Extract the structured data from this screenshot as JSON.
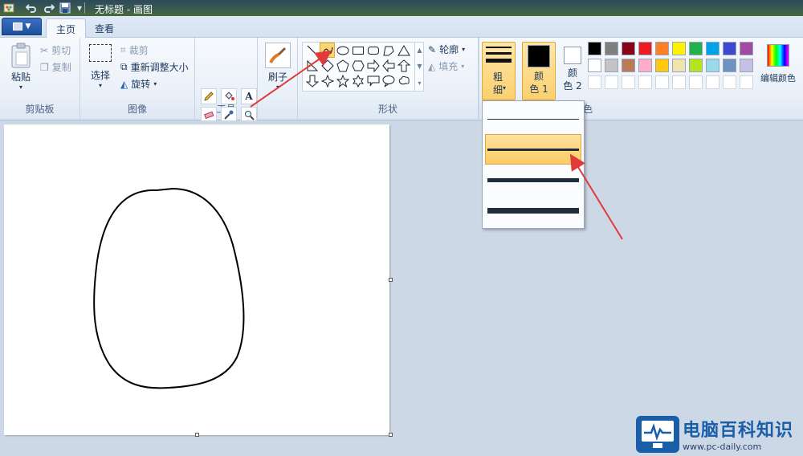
{
  "window": {
    "title": "无标题 - 画图"
  },
  "tabs": [
    {
      "label": "主页",
      "active": true
    },
    {
      "label": "查看",
      "active": false
    }
  ],
  "clipboard": {
    "paste": "粘贴",
    "cut": "剪切",
    "copy": "复制",
    "group": "剪贴板"
  },
  "image": {
    "select": "选择",
    "crop": "裁剪",
    "resize": "重新调整大小",
    "rotate": "旋转",
    "group": "图像"
  },
  "tools": {
    "group": "工具",
    "text_glyph": "A"
  },
  "brushes": {
    "label": "刷子"
  },
  "shapes": {
    "group": "形状",
    "outline": "轮廓",
    "fill": "填充",
    "selected": "curve"
  },
  "size": {
    "label_line1": "粗",
    "label_line2": "细",
    "options": 4,
    "selected_index": 1
  },
  "colors": {
    "color1_label_a": "颜",
    "color1_label_b": "色 1",
    "color2_label_a": "颜",
    "color2_label_b": "色 2",
    "color1": "#000000",
    "color2": "#ffffff",
    "edit": "编辑颜色",
    "group": "颜色",
    "palette_row1": [
      "#000000",
      "#7f7f7f",
      "#880015",
      "#ed1c24",
      "#ff7f27",
      "#fff200",
      "#22b14c",
      "#00a2e8",
      "#3f48cc",
      "#a349a4"
    ],
    "palette_row2": [
      "#ffffff",
      "#c3c3c3",
      "#b97a57",
      "#ffaec9",
      "#ffc90e",
      "#efe4b0",
      "#b5e61d",
      "#99d9ea",
      "#7092be",
      "#c8bfe7"
    ]
  },
  "watermark": {
    "brand": "电脑百科知识",
    "url": "www.pc-daily.com"
  },
  "accent": "#e03a3a"
}
